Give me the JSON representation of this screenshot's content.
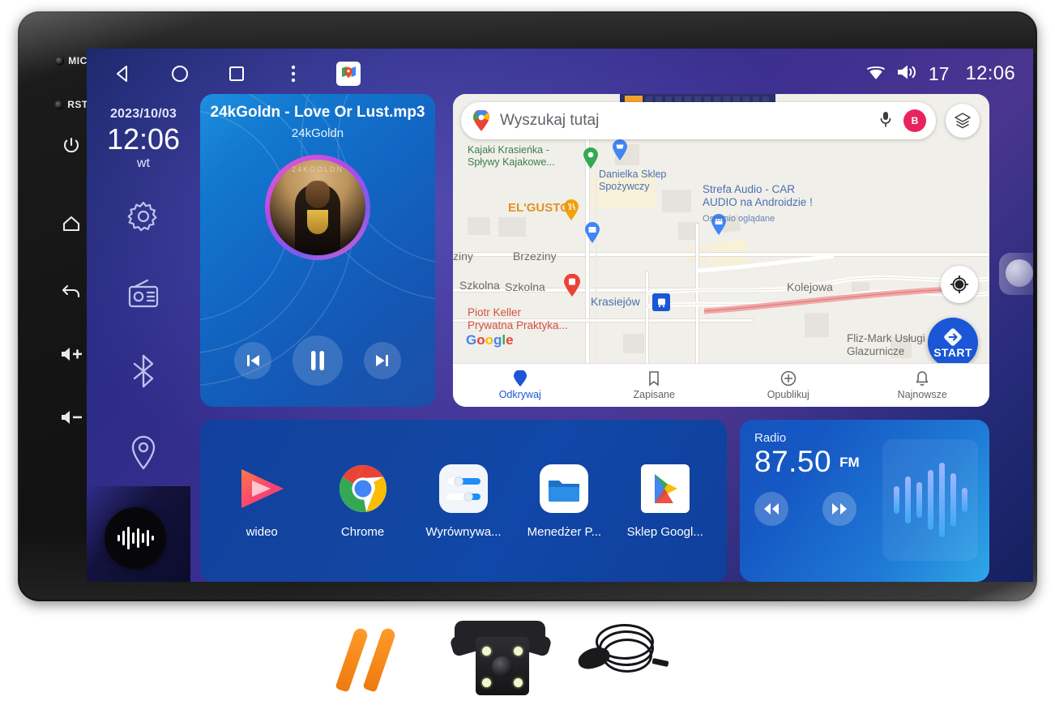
{
  "device": {
    "hardware_buttons": [
      {
        "name": "mic",
        "label": "MIC"
      },
      {
        "name": "rst",
        "label": "RST"
      },
      {
        "name": "power",
        "label": ""
      },
      {
        "name": "home",
        "label": ""
      },
      {
        "name": "back",
        "label": ""
      },
      {
        "name": "volume-up",
        "label": ""
      },
      {
        "name": "volume-down",
        "label": ""
      }
    ]
  },
  "statusbar": {
    "nav": [
      {
        "name": "back",
        "icon": "triangle-left-icon"
      },
      {
        "name": "home",
        "icon": "circle-icon"
      },
      {
        "name": "recents",
        "icon": "square-icon"
      },
      {
        "name": "more",
        "icon": "dots-vertical-icon"
      },
      {
        "name": "google-maps",
        "icon": "google-maps-icon"
      }
    ],
    "wifi_icon": "wifi-icon",
    "volume_icon": "speaker-icon",
    "volume_level": "17",
    "clock": "12:06"
  },
  "leftpanel": {
    "date": "2023/10/03",
    "time": "12:06",
    "weekday": "wt",
    "icons": [
      {
        "name": "settings",
        "icon": "gear-icon"
      },
      {
        "name": "radio",
        "icon": "radio-icon"
      },
      {
        "name": "bluetooth",
        "icon": "bluetooth-icon"
      },
      {
        "name": "navigation",
        "icon": "location-pin-icon"
      }
    ],
    "visualizer_badge": "audio-waveform-icon"
  },
  "music": {
    "title": "24kGoldn - Love Or Lust.mp3",
    "artist": "24kGoldn",
    "album_art_text": "24KGOLDN",
    "controls": [
      {
        "name": "previous",
        "icon": "skip-previous-icon"
      },
      {
        "name": "pause",
        "icon": "pause-icon"
      },
      {
        "name": "next",
        "icon": "skip-next-icon"
      }
    ]
  },
  "map": {
    "search_placeholder": "Wyszukaj tutaj",
    "search_value": "",
    "mic_icon": "microphone-icon",
    "avatar_initial": "B",
    "layers_icon": "layers-icon",
    "locate_icon": "my-location-icon",
    "start_label": "START",
    "attribution": "Google",
    "labels": [
      {
        "text": "Kajaki Krasieńka -\nSpływy Kajakowe...",
        "kind": "green"
      },
      {
        "text": "Danielka Sklep\nSpożywczy",
        "kind": "blue"
      },
      {
        "text": "Strefa Audio - CAR\nAUDIO na Androidzie !",
        "kind": "blue"
      },
      {
        "text": "Ostatnio oglądane",
        "kind": "blue-small"
      },
      {
        "text": "EL'GUSTO",
        "kind": "orange"
      },
      {
        "text": "Brzeziny",
        "kind": "grey"
      },
      {
        "text": "ziny",
        "kind": "grey"
      },
      {
        "text": "Szkolna",
        "kind": "grey"
      },
      {
        "text": "Szkolna",
        "kind": "grey"
      },
      {
        "text": "Kolejowa",
        "kind": "grey"
      },
      {
        "text": "Krasiejów",
        "kind": "blue"
      },
      {
        "text": "Piotr Keller\nPrywatna Praktyka...",
        "kind": "red"
      },
      {
        "text": "Fliz-Mark Usługi\nGlazurnicze",
        "kind": "grey"
      }
    ],
    "bottom_nav": [
      {
        "label": "Odkrywaj",
        "icon": "location-pin-icon",
        "active": true
      },
      {
        "label": "Zapisane",
        "icon": "bookmark-icon",
        "active": false
      },
      {
        "label": "Opublikuj",
        "icon": "plus-circle-icon",
        "active": false
      },
      {
        "label": "Najnowsze",
        "icon": "bell-icon",
        "active": false
      }
    ]
  },
  "apps": [
    {
      "label": "wideo",
      "icon": "video-player-icon"
    },
    {
      "label": "Chrome",
      "icon": "chrome-icon"
    },
    {
      "label": "Wyrównywa...",
      "icon": "equalizer-icon"
    },
    {
      "label": "Menedżer P...",
      "icon": "file-manager-icon"
    },
    {
      "label": "Sklep Googl...",
      "icon": "play-store-icon"
    }
  ],
  "radio": {
    "title": "Radio",
    "frequency": "87.50",
    "band": "FM",
    "controls": [
      {
        "name": "seek-down",
        "icon": "rewind-icon"
      },
      {
        "name": "seek-up",
        "icon": "fast-forward-icon"
      }
    ],
    "visualizer_bars": [
      34,
      58,
      44,
      74,
      92,
      66,
      30
    ]
  },
  "accessories": [
    {
      "name": "pry-tools",
      "label": ""
    },
    {
      "name": "rear-view-camera",
      "label": ""
    },
    {
      "name": "external-microphone",
      "label": ""
    }
  ],
  "colors": {
    "screen_blue": "#2a2c86",
    "accent_blue": "#1a56d6",
    "card_blue": "#1266c3",
    "map_bg": "#f1efe9"
  }
}
